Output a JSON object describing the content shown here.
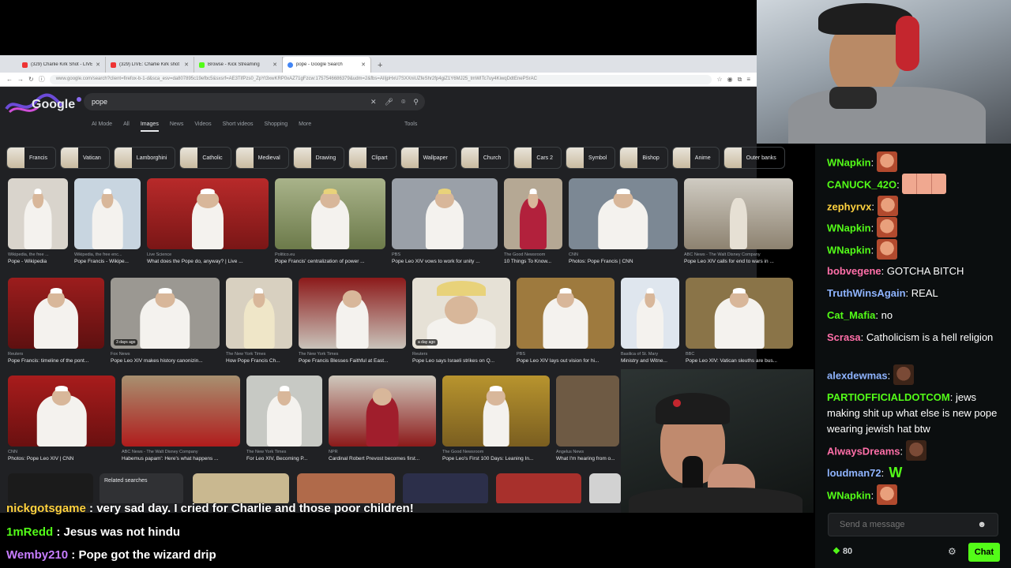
{
  "browser": {
    "tabs": [
      {
        "label": "(329) Charlie Kirk Shot - LIVE R",
        "icon": "youtube-icon"
      },
      {
        "label": "(329) LIVE: Charlie Kirk shot an",
        "icon": "youtube-icon"
      },
      {
        "label": "Browse - Kick Streaming",
        "icon": "kick-icon"
      },
      {
        "label": "pope - Google Search",
        "icon": "google-icon"
      }
    ],
    "url": "www.google.com/search?client=firefox-b-1-d&sca_esv=da807895c19efbc5&sxsrf=AE3TifPzs0_ZpYt3xwKRP0xAZ71gFzcw:1757546686379&udm=2&fbs=AIIjpHxU7SXXniUZfeShr2fp4giZ1Y6MJ25_tmWITc7uy4KiwqDdtEnePSrAC"
  },
  "google": {
    "logo_text": "Google",
    "query": "pope",
    "tabs": [
      "AI Mode",
      "All",
      "Images",
      "News",
      "Videos",
      "Short videos",
      "Shopping",
      "More"
    ],
    "active_tab": "Images",
    "tools_label": "Tools",
    "chips": [
      "Francis",
      "Vatican",
      "Lamborghini",
      "Catholic",
      "Medieval",
      "Drawing",
      "Clipart",
      "Wallpaper",
      "Church",
      "Cars 2",
      "Symbol",
      "Bishop",
      "Anime",
      "Outer banks"
    ],
    "related_label": "Related searches"
  },
  "results_row1": [
    {
      "source": "Wikipedia, the free ...",
      "title": "Pope - Wikipedia"
    },
    {
      "source": "Wikipedia, the free enc...",
      "title": "Pope Francis - Wikipe..."
    },
    {
      "source": "Live Science",
      "title": "What does the Pope do, anyway? | Live ..."
    },
    {
      "source": "Politico.eu",
      "title": "Pope Francis' centralization of power ..."
    },
    {
      "source": "PBS",
      "title": "Pope Leo XIV vows to work for unity ..."
    },
    {
      "source": "The Good Newsroom",
      "title": "10 Things To Know..."
    },
    {
      "source": "CNN",
      "title": "Photos: Pope Francis | CNN"
    },
    {
      "source": "ABC News - The Walt Disney Company",
      "title": "Pope Leo XIV calls for end to wars in ..."
    }
  ],
  "results_row2": [
    {
      "source": "Reuters",
      "title": "Pope Francis: timeline of the pont...",
      "badge": ""
    },
    {
      "source": "Fox News",
      "title": "Pope Leo XIV makes history canonizin...",
      "badge": "3 days ago"
    },
    {
      "source": "The New York Times",
      "title": "How Pope Francis Ch...",
      "badge": ""
    },
    {
      "source": "The New York Times",
      "title": "Pope Francis Blesses Faithful at East...",
      "badge": ""
    },
    {
      "source": "Reuters",
      "title": "Pope Leo says Israeli strikes on Q...",
      "badge": "a day ago"
    },
    {
      "source": "PBS",
      "title": "Pope Leo XIV lays out vision for hi...",
      "badge": ""
    },
    {
      "source": "Basilica of St. Mary",
      "title": "Ministry and Witne...",
      "badge": ""
    },
    {
      "source": "BBC",
      "title": "Pope Leo XIV: Vatican sleuths are bus...",
      "badge": ""
    }
  ],
  "results_row3": [
    {
      "source": "CNN",
      "title": "Photos: Pope Leo XIV | CNN"
    },
    {
      "source": "ABC News - The Walt Disney Company",
      "title": "Habemus papam': Here's what happens ..."
    },
    {
      "source": "The New York Times",
      "title": "For Leo XIV, Becoming P..."
    },
    {
      "source": "NPR",
      "title": "Cardinal Robert Prevost becomes first..."
    },
    {
      "source": "The Good Newsroom",
      "title": "Pope Leo's First 100 Days: Leaning In..."
    },
    {
      "source": "Angelus News",
      "title": "What I'm hearing from o..."
    }
  ],
  "chat": {
    "messages": [
      {
        "user": "WNapkin",
        "color": "#53fc18",
        "text": "",
        "emotes": [
          "face"
        ]
      },
      {
        "user": "CANUCK_42O",
        "color": "#53fc18",
        "text": "",
        "emotes": [
          "wide"
        ]
      },
      {
        "user": "zephyrvx",
        "color": "#ffd23f",
        "text": "",
        "emotes": [
          "face"
        ]
      },
      {
        "user": "WNapkin",
        "color": "#53fc18",
        "text": "",
        "emotes": [
          "face"
        ]
      },
      {
        "user": "WNapkin",
        "color": "#53fc18",
        "text": "",
        "emotes": [
          "face"
        ]
      },
      {
        "user": "bobvegene",
        "color": "#ff6fa8",
        "text": "GOTCHA BITCH",
        "emotes": []
      },
      {
        "user": "TruthWinsAgain",
        "color": "#8fb4ff",
        "text": "REAL",
        "emotes": []
      },
      {
        "user": "Cat_Mafia",
        "color": "#53fc18",
        "text": "no",
        "emotes": []
      },
      {
        "user": "Scrasa",
        "color": "#ff6fa8",
        "text": "Catholicism is a hell religion",
        "emotes": []
      },
      {
        "user": "alexdewmas",
        "color": "#8fb4ff",
        "text": "",
        "emotes": [
          "dark"
        ]
      },
      {
        "user": "PARTIOFFICIALDOTCOM",
        "color": "#53fc18",
        "text": "jews making shit up what else is new pope wearing jewish hat btw",
        "emotes": []
      },
      {
        "user": "AlwaysDreams",
        "color": "#ff6fa8",
        "text": "",
        "emotes": [
          "dark"
        ]
      },
      {
        "user": "loudman72",
        "color": "#8fb4ff",
        "text": "",
        "emotes": [
          "w"
        ]
      },
      {
        "user": "WNapkin",
        "color": "#53fc18",
        "text": "",
        "emotes": [
          "face"
        ]
      }
    ],
    "input_placeholder": "Send a message",
    "points": "80",
    "send_label": "Chat"
  },
  "overlay_chat": [
    {
      "user": "nickgotsgame",
      "color": "#ffd23f",
      "text": " : very sad day. I cried for Charlie and those poor children!"
    },
    {
      "user": "1mRedd",
      "color": "#53fc18",
      "text": " : Jesus was not hindu"
    },
    {
      "user": "Wemby210",
      "color": "#c77dff",
      "text": " : Pope got the wizard drip"
    }
  ]
}
